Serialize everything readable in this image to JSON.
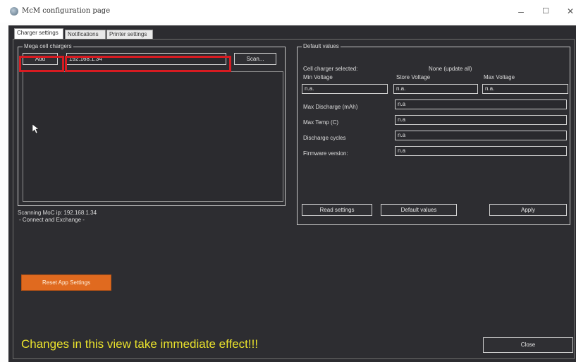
{
  "window": {
    "title": "McM configuration page",
    "controls": {
      "minimize": "–",
      "maximize": "☐",
      "close": "✕"
    }
  },
  "tabs": [
    {
      "label": "Charger settings",
      "active": true
    },
    {
      "label": "Notifications",
      "active": false
    },
    {
      "label": "Printer settings",
      "active": false
    }
  ],
  "chargers_group": {
    "title": "Mega cell chargers",
    "add_label": "Add",
    "ip_value": "192.168.1.34",
    "scan_label": "Scan..."
  },
  "status": {
    "line1": "Scanning MoC ip: 192.168.1.34",
    "line2": "- Connect and Exchange -"
  },
  "defaults_group": {
    "title": "Default values",
    "charger_selected_label": "Cell charger selected:",
    "charger_selected_value": "None (update all)",
    "min_voltage_label": "Min Voltage",
    "store_voltage_label": "Store Voltage",
    "max_voltage_label": "Max Voltage",
    "min_voltage_value": "n.a.",
    "store_voltage_value": "n.a.",
    "max_voltage_value": "n.a.",
    "max_discharge_label": "Max Discharge (mAh)",
    "max_discharge_value": "n.a",
    "max_temp_label": "Max Temp (C)",
    "max_temp_value": "n.a",
    "discharge_cycles_label": "Discharge cycles",
    "discharge_cycles_value": "n.a",
    "firmware_label": "Firmware version:",
    "firmware_value": "n.a",
    "read_settings_label": "Read settings",
    "default_values_label": "Default values",
    "apply_label": "Apply"
  },
  "reset_label": "Reset App Settings",
  "warning_text": "Changes in this view take immediate effect!!!",
  "close_label": "Close",
  "colors": {
    "background": "#2d2d31",
    "highlight_box": "#d81b21",
    "reset_button": "#e06a1f",
    "warning_text": "#e9e12c"
  }
}
